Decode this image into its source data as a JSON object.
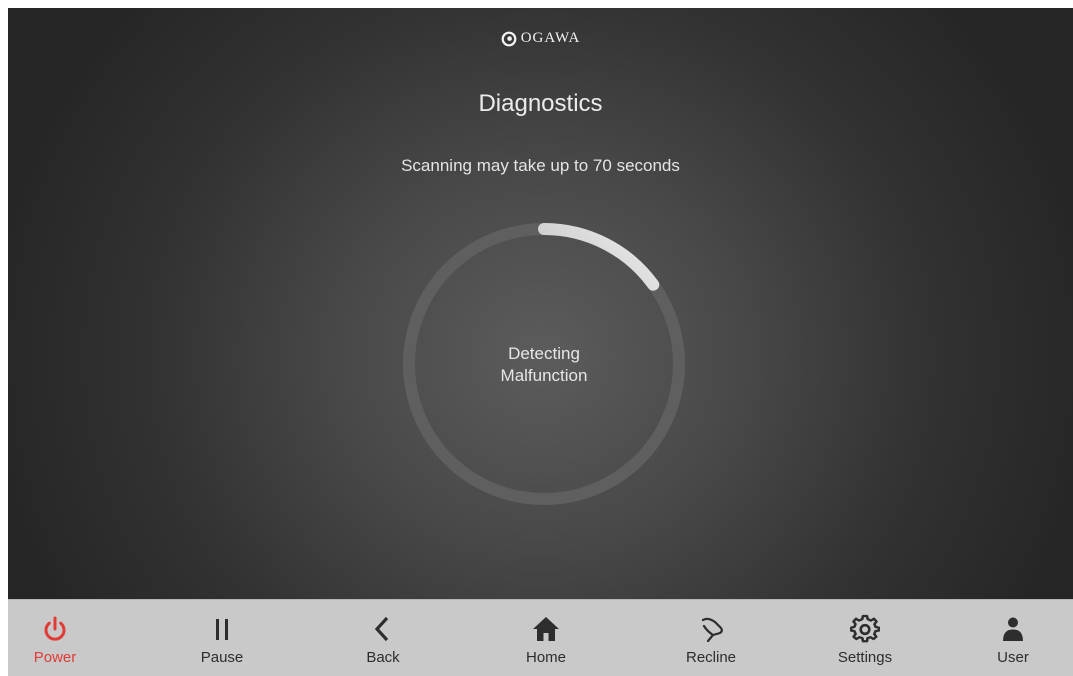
{
  "header": {
    "logo_text": "OGAWA",
    "logo_icon": "ogawa-swirl-logo"
  },
  "page": {
    "title": "Diagnostics",
    "subtitle": "Scanning may take up to 70 seconds"
  },
  "scan": {
    "status_line1": "Detecting",
    "status_line2": "Malfunction",
    "progress_fraction": 0.15
  },
  "colors": {
    "accent_power": "#e23b35",
    "nav_background": "#c9c9c9",
    "nav_icon": "#2d2d2d",
    "ring_track": "#5f5f5f",
    "ring_progress": "#e9e9e9"
  },
  "navbar": {
    "items": [
      {
        "label": "Power",
        "icon": "power-icon"
      },
      {
        "label": "Pause",
        "icon": "pause-icon"
      },
      {
        "label": "Back",
        "icon": "chevron-left-icon"
      },
      {
        "label": "Home",
        "icon": "home-icon"
      },
      {
        "label": "Recline",
        "icon": "recline-icon"
      },
      {
        "label": "Settings",
        "icon": "gear-icon"
      },
      {
        "label": "User",
        "icon": "user-icon"
      }
    ]
  }
}
